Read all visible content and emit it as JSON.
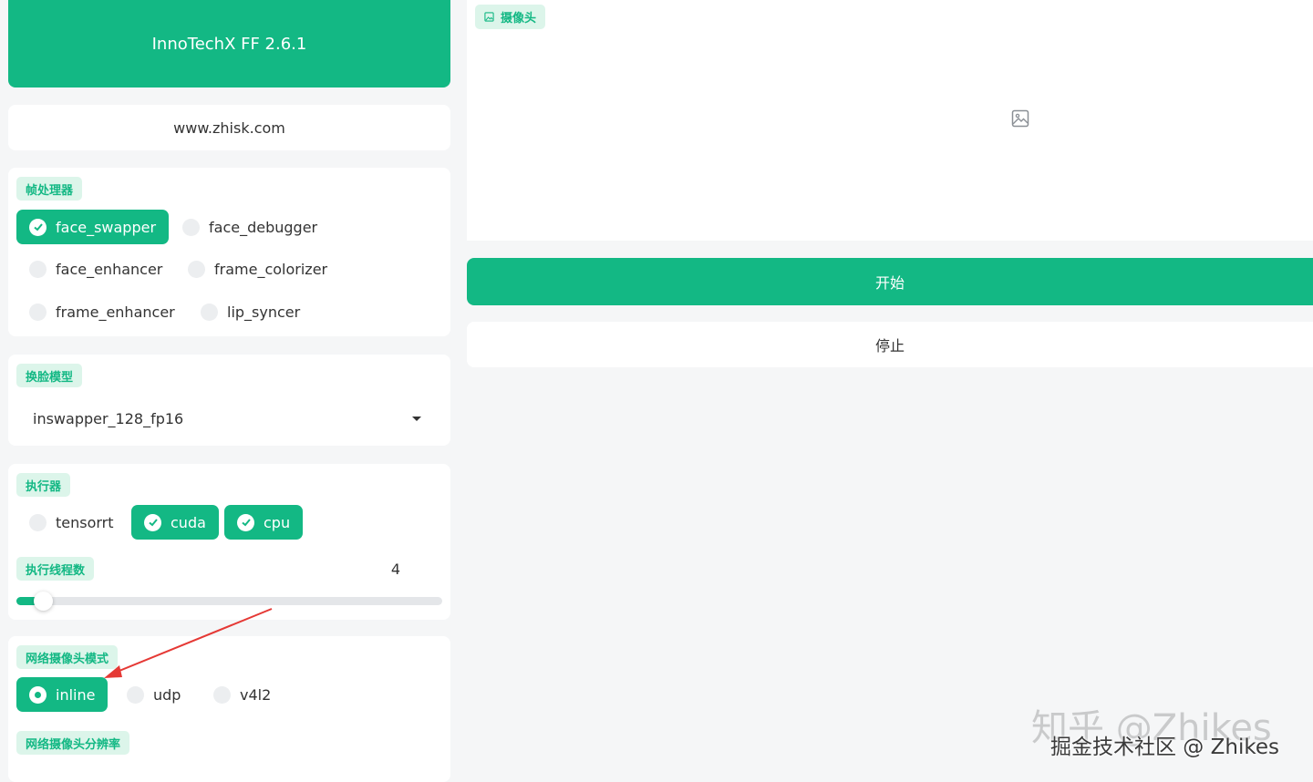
{
  "app": {
    "title": "InnoTechX FF 2.6.1",
    "url": "www.zhisk.com"
  },
  "frame_processors": {
    "label": "帧处理器",
    "options": [
      {
        "label": "face_swapper",
        "checked": true
      },
      {
        "label": "face_debugger",
        "checked": false
      },
      {
        "label": "face_enhancer",
        "checked": false
      },
      {
        "label": "frame_colorizer",
        "checked": false
      },
      {
        "label": "frame_enhancer",
        "checked": false
      },
      {
        "label": "lip_syncer",
        "checked": false
      }
    ]
  },
  "face_swapper_model": {
    "label": "换脸模型",
    "value": "inswapper_128_fp16"
  },
  "executors": {
    "label": "执行器",
    "options": [
      {
        "label": "tensorrt",
        "checked": false
      },
      {
        "label": "cuda",
        "checked": true
      },
      {
        "label": "cpu",
        "checked": true
      }
    ]
  },
  "thread_count": {
    "label": "执行线程数",
    "value": "4",
    "fraction": 0.04
  },
  "webcam_mode": {
    "label": "网络摄像头模式",
    "options": [
      {
        "label": "inline",
        "selected": true
      },
      {
        "label": "udp",
        "selected": false
      },
      {
        "label": "v4l2",
        "selected": false
      }
    ]
  },
  "webcam_resolution": {
    "label": "网络摄像头分辨率"
  },
  "camera": {
    "label": "摄像头"
  },
  "buttons": {
    "start": "开始",
    "stop": "停止"
  },
  "watermark": {
    "large": "知乎 @Zhikes",
    "small": "掘金技术社区 @ Zhikes"
  },
  "colors": {
    "accent": "#13b884",
    "label_bg": "#dcf5ea",
    "annotation_arrow": "#e53935"
  }
}
